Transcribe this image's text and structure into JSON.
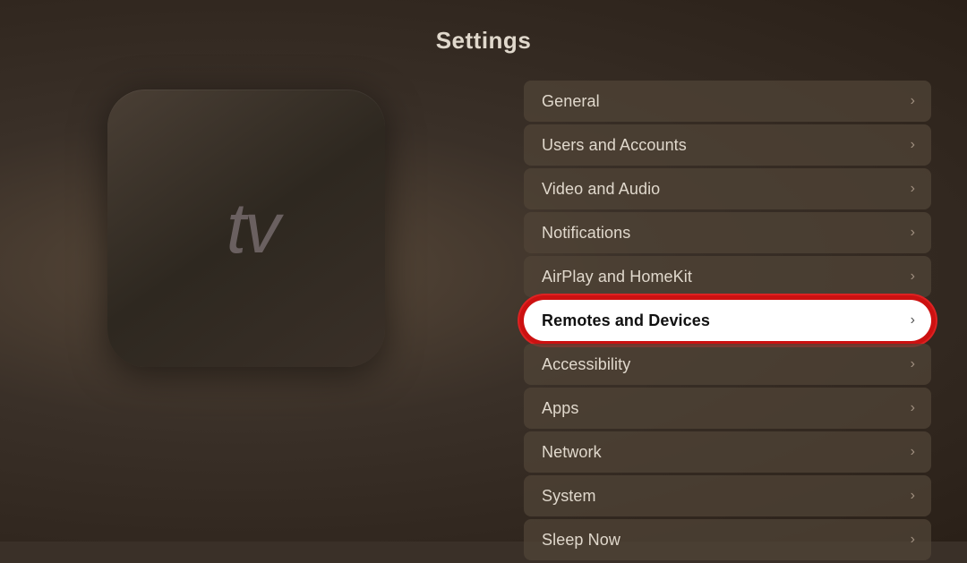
{
  "page": {
    "title": "Settings"
  },
  "settings": {
    "items": [
      {
        "id": "general",
        "label": "General",
        "highlighted": false
      },
      {
        "id": "users-and-accounts",
        "label": "Users and Accounts",
        "highlighted": false
      },
      {
        "id": "video-and-audio",
        "label": "Video and Audio",
        "highlighted": false
      },
      {
        "id": "notifications",
        "label": "Notifications",
        "highlighted": false
      },
      {
        "id": "airplay-and-homekit",
        "label": "AirPlay and HomeKit",
        "highlighted": false
      },
      {
        "id": "remotes-and-devices",
        "label": "Remotes and Devices",
        "highlighted": true
      },
      {
        "id": "accessibility",
        "label": "Accessibility",
        "highlighted": false
      },
      {
        "id": "apps",
        "label": "Apps",
        "highlighted": false
      },
      {
        "id": "network",
        "label": "Network",
        "highlighted": false
      },
      {
        "id": "system",
        "label": "System",
        "highlighted": false
      },
      {
        "id": "sleep-now",
        "label": "Sleep Now",
        "highlighted": false
      }
    ]
  },
  "icons": {
    "chevron": "›",
    "apple": ""
  }
}
